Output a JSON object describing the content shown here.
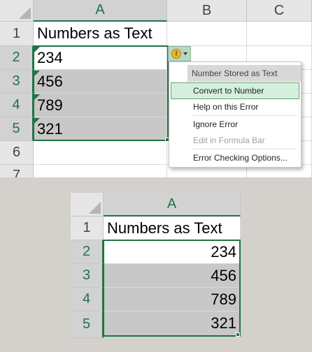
{
  "top": {
    "columns": [
      "A",
      "B",
      "C"
    ],
    "rows": [
      "1",
      "2",
      "3",
      "4",
      "5",
      "6",
      "7"
    ],
    "header": "Numbers as Text",
    "values": [
      "234",
      "456",
      "789",
      "321"
    ]
  },
  "error_menu": {
    "title": "Number Stored as Text",
    "items": [
      "Convert to Number",
      "Help on this Error",
      "Ignore Error",
      "Edit in Formula Bar",
      "Error Checking Options..."
    ],
    "warning_glyph": "!"
  },
  "bottom": {
    "columns": [
      "A"
    ],
    "rows": [
      "1",
      "2",
      "3",
      "4",
      "5"
    ],
    "header": "Numbers as Text",
    "values": [
      "234",
      "456",
      "789",
      "321"
    ]
  },
  "colors": {
    "excel_green": "#217346",
    "selection_shade": "#c8c8c8",
    "warning_yellow": "#e8b730",
    "menu_highlight": "#d4f0dc"
  },
  "icons": [
    "select-all-triangle",
    "error-warning-icon",
    "dropdown-caret-icon",
    "green-error-indicator"
  ]
}
